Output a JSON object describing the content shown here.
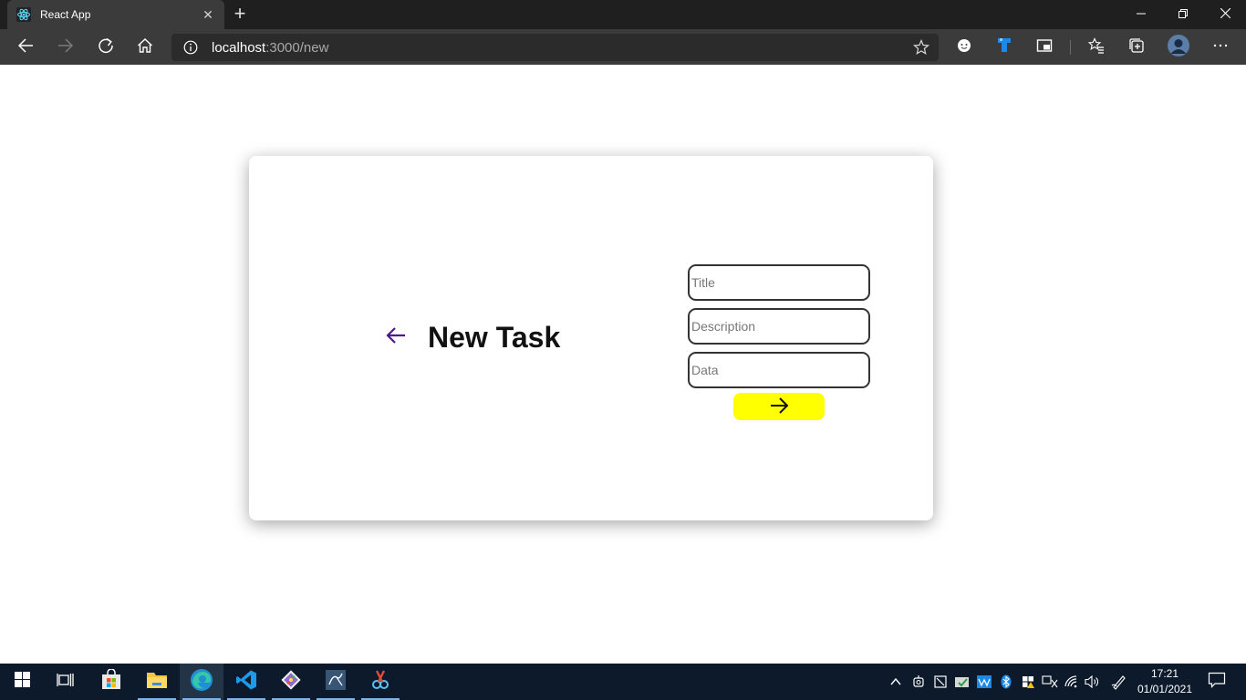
{
  "browser": {
    "tab": {
      "title": "React App",
      "favicon": "react-icon",
      "close_glyph": "✕"
    },
    "new_tab_glyph": "+",
    "window_controls": {
      "minimize": "minimize-icon",
      "restore": "restore-icon",
      "close": "close-icon"
    },
    "toolbar": {
      "back": "back-icon",
      "forward": "forward-icon",
      "refresh": "refresh-icon",
      "home": "home-icon"
    },
    "address": {
      "host": "localhost",
      "path": ":3000/new",
      "info": "info-icon",
      "favorite": "star-icon"
    },
    "extensions": [
      "emoji-extension-icon",
      "tag-extension-icon",
      "picture-in-picture-icon",
      "favorites-icon",
      "collections-icon",
      "profile-avatar",
      "more-icon"
    ]
  },
  "page": {
    "back_icon": "arrow-left-icon",
    "title": "New Task",
    "form": {
      "title_placeholder": "Title",
      "description_placeholder": "Description",
      "data_placeholder": "Data",
      "submit_icon": "arrow-right-icon"
    }
  },
  "colors": {
    "back_arrow": "#4b1a8c",
    "submit_button": "#ffff00",
    "taskbar": "#0d1a2b",
    "chrome_dark": "#1f1f1f",
    "chrome_toolbar": "#3b3b3b"
  },
  "taskbar": {
    "apps": [
      "windows-start-icon",
      "task-view-icon",
      "microsoft-store-icon",
      "file-explorer-icon",
      "edge-icon",
      "vscode-icon",
      "git-icon",
      "sql-icon",
      "snip-icon"
    ],
    "active_app": "edge-icon",
    "tray": [
      "chevron-up-icon",
      "meet-now-icon",
      "tray-app-icon",
      "onedrive-icon",
      "performance-icon",
      "bluetooth-icon",
      "security-icon",
      "input-icon",
      "wifi-icon",
      "volume-icon",
      "pen-icon"
    ],
    "time": "17:21",
    "date": "01/01/2021",
    "notifications": "notifications-icon"
  }
}
